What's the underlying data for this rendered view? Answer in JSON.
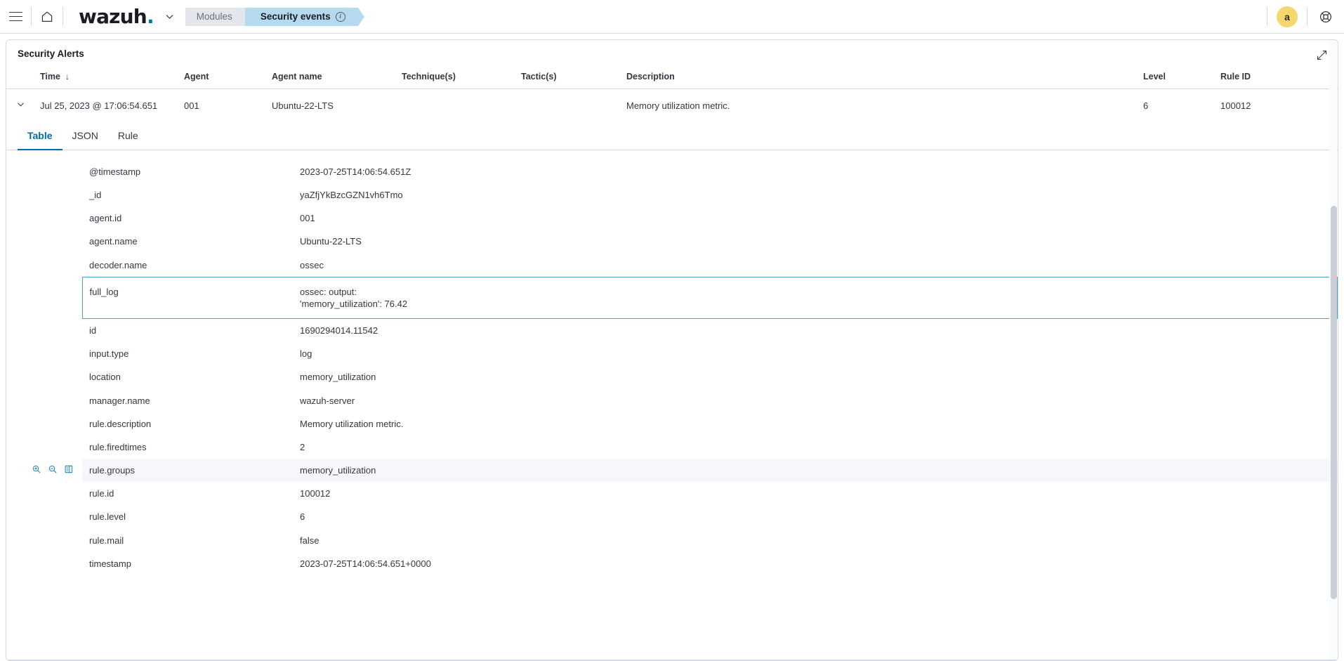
{
  "topnav": {
    "menu_label": "Toggle navigation",
    "home_label": "Home",
    "brand": "wazuh",
    "brand_dot": ".",
    "breadcrumbs": [
      {
        "label": "Modules",
        "active": false
      },
      {
        "label": "Security events",
        "active": true,
        "has_info": true
      }
    ],
    "avatar_initial": "a",
    "help_label": "Help"
  },
  "panel": {
    "title": "Security Alerts",
    "expand_label": "Expand"
  },
  "alerts": {
    "columns": [
      "Time",
      "Agent",
      "Agent name",
      "Technique(s)",
      "Tactic(s)",
      "Description",
      "Level",
      "Rule ID"
    ],
    "sort_column": "Time",
    "sort_direction": "desc",
    "sort_glyph": "↓",
    "rows": [
      {
        "expanded": true,
        "time": "Jul 25, 2023 @ 17:06:54.651",
        "agent": "001",
        "agent_name": "Ubuntu-22-LTS",
        "techniques": "",
        "tactics": "",
        "description": "Memory utilization metric.",
        "level": "6",
        "rule_id": "100012"
      }
    ]
  },
  "detail_tabs": [
    {
      "label": "Table",
      "active": true
    },
    {
      "label": "JSON",
      "active": false
    },
    {
      "label": "Rule",
      "active": false
    }
  ],
  "detail_fields": [
    {
      "field": "@timestamp",
      "value": "2023-07-25T14:06:54.651Z",
      "state": "normal"
    },
    {
      "field": "_id",
      "value": "yaZfjYkBzcGZN1vh6Tmo",
      "state": "normal"
    },
    {
      "field": "agent.id",
      "value": "001",
      "state": "normal"
    },
    {
      "field": "agent.name",
      "value": "Ubuntu-22-LTS",
      "state": "normal"
    },
    {
      "field": "decoder.name",
      "value": "ossec",
      "state": "normal"
    },
    {
      "field": "full_log",
      "value": "ossec: output: 'memory_utilization': 76.42",
      "state": "selected"
    },
    {
      "field": "id",
      "value": "1690294014.11542",
      "state": "normal"
    },
    {
      "field": "input.type",
      "value": "log",
      "state": "normal"
    },
    {
      "field": "location",
      "value": "memory_utilization",
      "state": "normal"
    },
    {
      "field": "manager.name",
      "value": "wazuh-server",
      "state": "normal"
    },
    {
      "field": "rule.description",
      "value": "Memory utilization metric.",
      "state": "normal"
    },
    {
      "field": "rule.firedtimes",
      "value": "2",
      "state": "normal"
    },
    {
      "field": "rule.groups",
      "value": "memory_utilization",
      "state": "hovered"
    },
    {
      "field": "rule.id",
      "value": "100012",
      "state": "normal"
    },
    {
      "field": "rule.level",
      "value": "6",
      "state": "normal"
    },
    {
      "field": "rule.mail",
      "value": "false",
      "state": "normal"
    },
    {
      "field": "timestamp",
      "value": "2023-07-25T14:06:54.651+0000",
      "state": "normal"
    }
  ],
  "row_actions": [
    {
      "name": "filter-for-value-icon",
      "title": "Filter for value"
    },
    {
      "name": "filter-out-value-icon",
      "title": "Filter out value"
    },
    {
      "name": "toggle-column-icon",
      "title": "Toggle column in table"
    }
  ],
  "colors": {
    "accent": "#006bb4",
    "link": "#006bb4",
    "crumb_active_bg": "#b5d9ef",
    "crumb_bg": "#e3e6eb",
    "avatar_bg": "#f5d76e",
    "border": "#d3dae6",
    "text": "#343741",
    "selected_border": "#4c9fd5",
    "hover_bg": "#f5f7fa"
  }
}
